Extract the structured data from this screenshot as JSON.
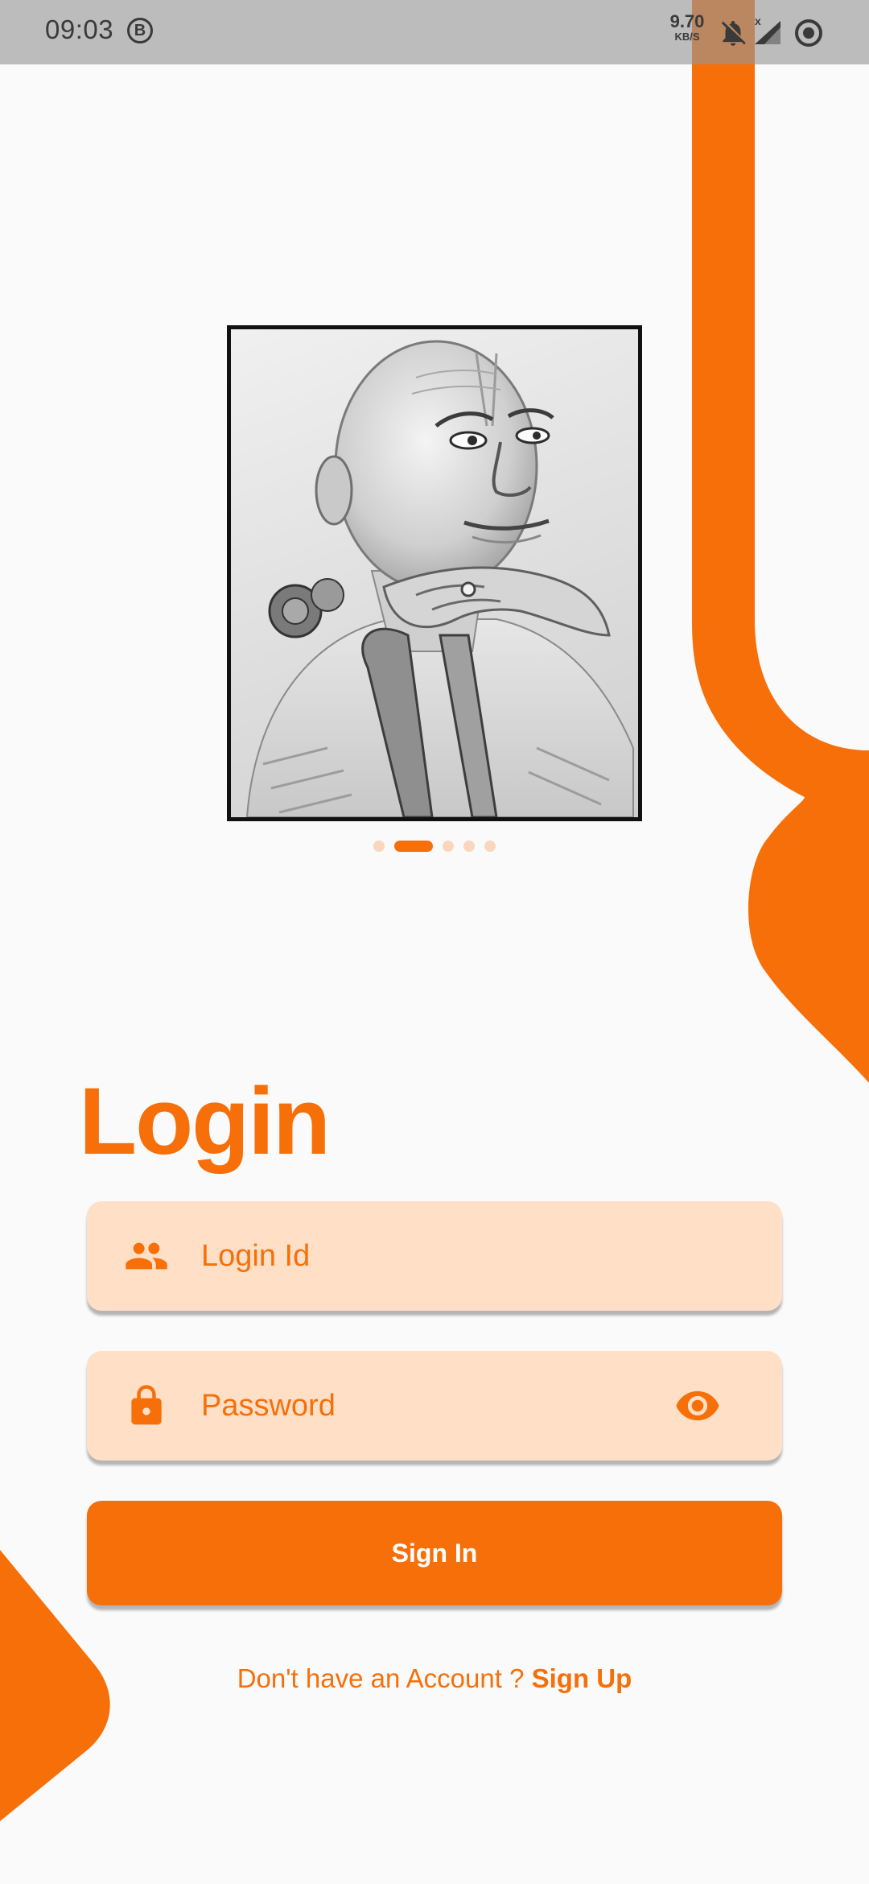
{
  "status_bar": {
    "time": "09:03",
    "app_badge": "B",
    "net_speed_value": "9.70",
    "net_speed_unit": "KB/S",
    "signal_badge": "x",
    "icons": [
      "b-badge-icon",
      "bell-off-icon",
      "signal-icon",
      "record-icon"
    ]
  },
  "carousel": {
    "image_kind": "pencil portrait",
    "dot_count": 5,
    "active_dot": 2
  },
  "login": {
    "title": "Login",
    "login_id": {
      "placeholder": "Login Id",
      "icon": "people-icon"
    },
    "password": {
      "placeholder": "Password",
      "icon": "lock-icon",
      "toggle_icon": "eye-icon"
    },
    "sign_in_label": "Sign In",
    "no_account_text": "Don't have an Account ?",
    "sign_up_label": "Sign Up"
  },
  "colors": {
    "accent": "#f76f09",
    "field_background": "#ffdfc6",
    "page_background": "#fafafa",
    "status_bar": "#969696"
  }
}
